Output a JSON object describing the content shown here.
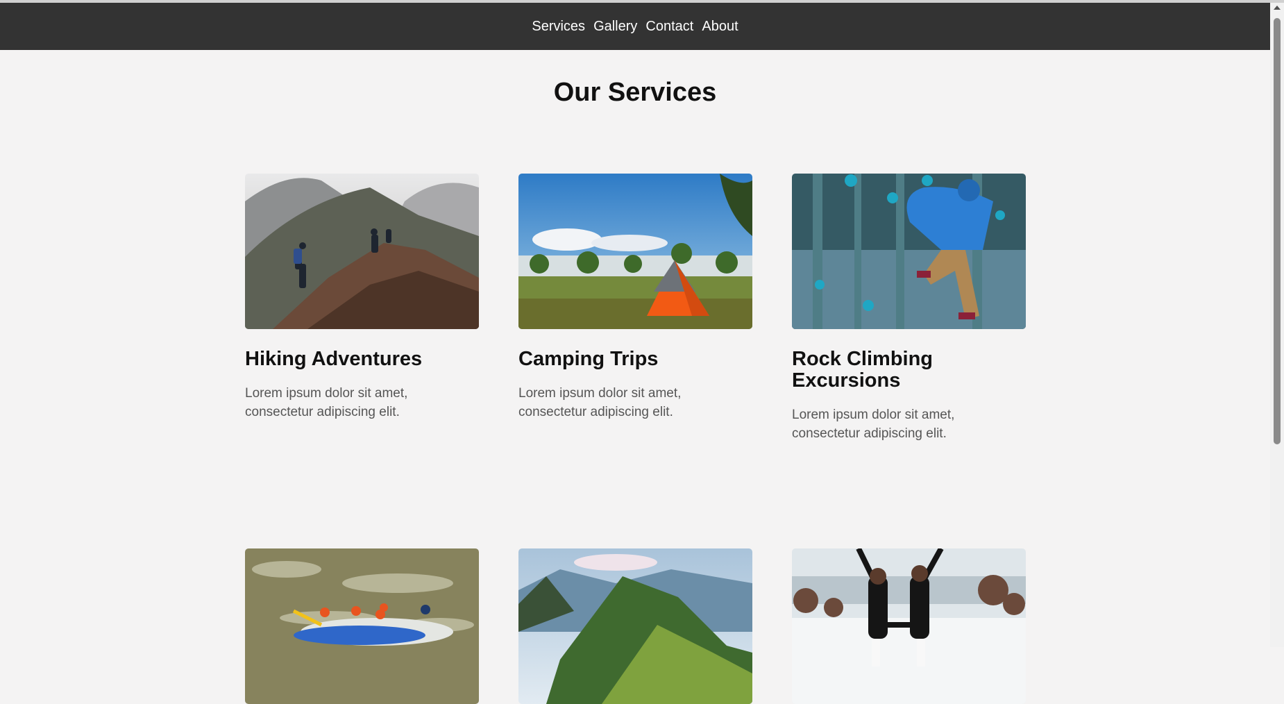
{
  "nav": {
    "links": [
      "Services",
      "Gallery",
      "Contact",
      "About"
    ]
  },
  "page": {
    "title": "Our Services"
  },
  "cards": [
    {
      "title": "Hiking Adventures",
      "text": "Lorem ipsum dolor sit amet, consectetur adipiscing elit.",
      "image": "hiking-photo"
    },
    {
      "title": "Camping Trips",
      "text": "Lorem ipsum dolor sit amet, consectetur adipiscing elit.",
      "image": "camping-photo"
    },
    {
      "title": "Rock Climbing Excursions",
      "text": "Lorem ipsum dolor sit amet, consectetur adipiscing elit.",
      "image": "climbing-photo"
    },
    {
      "title": "",
      "text": "",
      "image": "rafting-photo"
    },
    {
      "title": "",
      "text": "",
      "image": "mountains-photo"
    },
    {
      "title": "",
      "text": "",
      "image": "snow-photo"
    }
  ],
  "colors": {
    "navbar": "#333333",
    "background": "#f4f3f3",
    "heading": "#111111",
    "body_text": "#555555"
  }
}
